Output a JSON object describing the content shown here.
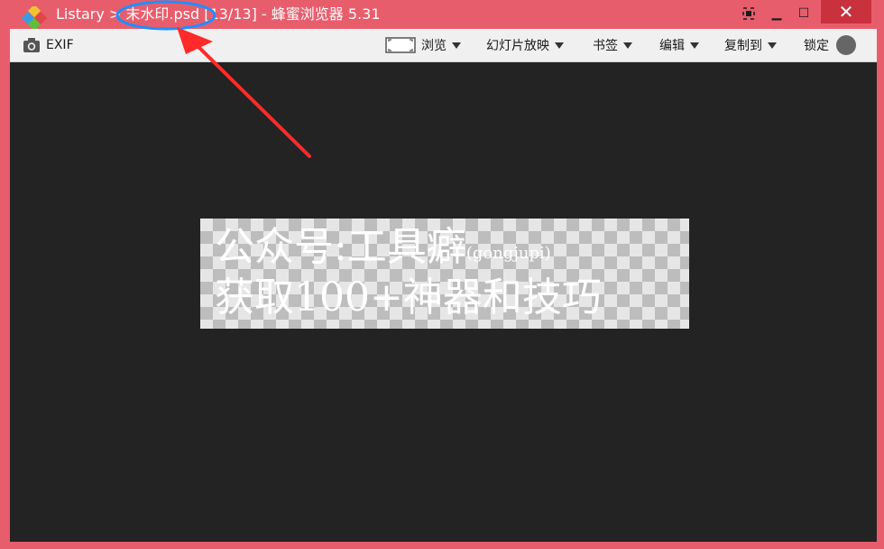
{
  "window": {
    "title_prefix": "Listary > ",
    "title_filename": "末水印.psd",
    "title_suffix": " [13/13] - 蜂蜜浏览器 5.31",
    "close_glyph": "✕",
    "minimize_glyph": "▁",
    "maximize_glyph": "☐"
  },
  "toolbar": {
    "exif_label": "EXIF",
    "browse_label": "浏览",
    "slideshow_label": "幻灯片放映",
    "bookmark_label": "书签",
    "edit_label": "编辑",
    "copyto_label": "复制到",
    "lock_label": "锁定"
  },
  "image": {
    "line1_main": "公众号:工具癖",
    "line1_sub": "(gongjupi)",
    "line2": "获取100+神器和技巧"
  },
  "colors": {
    "titlebar": "#e85d6c",
    "close_button": "#c9313d",
    "viewer_background": "#232323",
    "annotation_arrow": "#ff2a2a",
    "annotation_ellipse": "#1e8fff"
  },
  "icons": {
    "app": "honeyview-logo-icon",
    "camera": "camera-icon",
    "browse": "fullscreen-frame-icon"
  }
}
